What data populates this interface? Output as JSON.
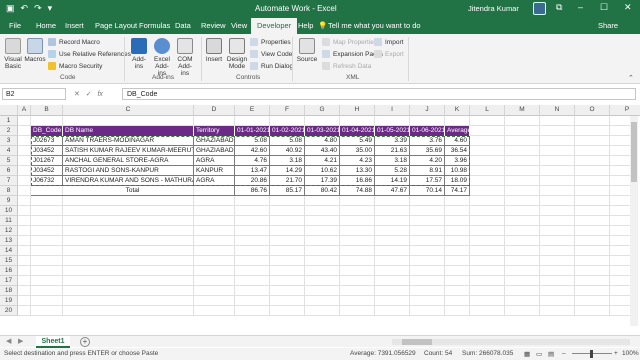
{
  "titlebar": {
    "title": "Automate Work  -  Excel",
    "user": "Jitendra Kumar"
  },
  "tabs": [
    "File",
    "Home",
    "Insert",
    "Page Layout",
    "Formulas",
    "Data",
    "Review",
    "View",
    "Developer",
    "Help"
  ],
  "active_tab": "Developer",
  "tell_me": "Tell me what you want to do",
  "share": "Share",
  "ribbon": {
    "visual_basic": "Visual Basic",
    "macros": "Macros",
    "record_macro": "Record Macro",
    "use_relative": "Use Relative References",
    "macro_security": "Macro Security",
    "code_group": "Code",
    "addins": "Add-ins",
    "excel_addins": "Excel Add-ins",
    "com_addins": "COM Add-ins",
    "addins_group": "Add-ins",
    "insert": "Insert",
    "design_mode": "Design Mode",
    "properties": "Properties",
    "view_code": "View Code",
    "run_dialog": "Run Dialog",
    "controls_group": "Controls",
    "source": "Source",
    "map_properties": "Map Properties",
    "expansion_packs": "Expansion Packs",
    "refresh_data": "Refresh Data",
    "import": "Import",
    "export": "Export",
    "xml_group": "XML"
  },
  "formula_bar": {
    "name_box": "B2",
    "formula": "DB_Code"
  },
  "columns": [
    "A",
    "B",
    "C",
    "D",
    "E",
    "F",
    "G",
    "H",
    "I",
    "J",
    "K",
    "L",
    "M",
    "N",
    "O",
    "P"
  ],
  "rows": [
    "1",
    "2",
    "3",
    "4",
    "5",
    "6",
    "7",
    "8",
    "9",
    "10",
    "11",
    "12",
    "13",
    "14",
    "15",
    "16",
    "17",
    "18",
    "19",
    "20"
  ],
  "table": {
    "headers": [
      "DB_Code",
      "DB Name",
      "Territory",
      "01-01-2021",
      "01-02-2021",
      "01-03-2021",
      "01-04-2021",
      "01-05-2021",
      "01-06-2021",
      "Average"
    ],
    "rows": [
      [
        "J02673",
        "AMAN TRAERS-MODINAGAR",
        "GHAZIABAD",
        "5.08",
        "5.08",
        "4.80",
        "5.49",
        "3.39",
        "3.76",
        "4.60"
      ],
      [
        "J03452",
        "SATISH KUMAR RAJEEV KUMAR-MEERUT",
        "GHAZIABAD",
        "42.60",
        "40.92",
        "43.40",
        "35.00",
        "21.63",
        "35.69",
        "36.54"
      ],
      [
        "J01267",
        "ANCHAL GENERAL STORE-AGRA",
        "AGRA",
        "4.76",
        "3.18",
        "4.21",
        "4.23",
        "3.18",
        "4.20",
        "3.96"
      ],
      [
        "J03452",
        "RASTOGI AND SONS-KANPUR",
        "KANPUR",
        "13.47",
        "14.29",
        "10.62",
        "13.30",
        "5.28",
        "8.91",
        "10.98"
      ],
      [
        "J06732",
        "VIRENDRA KUMAR AND SONS - MATHURA",
        "AGRA",
        "20.86",
        "21.70",
        "17.39",
        "16.86",
        "14.19",
        "17.57",
        "18.09"
      ]
    ],
    "total_label": "Total",
    "totals": [
      "86.76",
      "85.17",
      "80.42",
      "74.88",
      "47.67",
      "70.14",
      "74.17"
    ]
  },
  "sheet_tab": "Sheet1",
  "status": {
    "message": "Select destination and press ENTER or choose Paste",
    "average": "Average: 7391.056529",
    "count": "Count: 54",
    "sum": "Sum: 266078.035",
    "zoom": "100%"
  },
  "colors": {
    "excel_green": "#217346",
    "header_purple": "#6b2a86"
  }
}
